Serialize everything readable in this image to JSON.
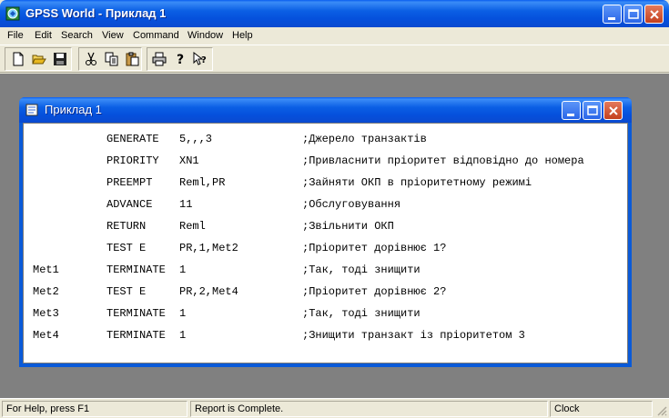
{
  "window": {
    "title": "GPSS World - Приклад 1",
    "icon": "gpss-app-icon"
  },
  "menu": [
    "File",
    "Edit",
    "Search",
    "View",
    "Command",
    "Window",
    "Help"
  ],
  "toolbar": {
    "buttons": [
      "new-icon",
      "open-folder-icon",
      "save-icon",
      "cut-icon",
      "copy-icon",
      "paste-icon",
      "print-icon",
      "help-icon",
      "context-help-icon"
    ]
  },
  "child_window": {
    "title": "Приклад 1",
    "icon": "document-icon"
  },
  "code": [
    {
      "label": "",
      "op": "GENERATE",
      "arg": "5,,,3",
      "comment": ";Джерело транзактів"
    },
    {
      "label": "",
      "op": "PRIORITY",
      "arg": "XN1",
      "comment": ";Привласнити пріоритет відповідно до номера"
    },
    {
      "label": "",
      "op": "PREEMPT",
      "arg": "Reml,PR",
      "comment": ";Зайняти ОКП в пріоритетному режимі"
    },
    {
      "label": "",
      "op": "ADVANCE",
      "arg": "11",
      "comment": ";Обслуговування"
    },
    {
      "label": "",
      "op": "RETURN",
      "arg": "Reml",
      "comment": ";Звільнити ОКП"
    },
    {
      "label": "",
      "op": "TEST E",
      "arg": "PR,1,Met2",
      "comment": ";Пріоритет дорівнює 1?"
    },
    {
      "label": "Met1",
      "op": "TERMINATE",
      "arg": "1",
      "comment": ";Так, тоді знищити"
    },
    {
      "label": "Met2",
      "op": "TEST E",
      "arg": "PR,2,Met4",
      "comment": ";Пріоритет дорівнює 2?"
    },
    {
      "label": "Met3",
      "op": "TERMINATE",
      "arg": "1",
      "comment": ";Так, тоді знищити"
    },
    {
      "label": "Met4",
      "op": "TERMINATE",
      "arg": "1",
      "comment": ";Знищити транзакт із пріоритетом 3"
    }
  ],
  "status": {
    "help": "For Help, press F1",
    "report": "Report is Complete.",
    "clock": "Clock"
  },
  "colors": {
    "titlebar": "#0550dc",
    "mdi_background": "#808080",
    "close_button": "#c4401e"
  }
}
